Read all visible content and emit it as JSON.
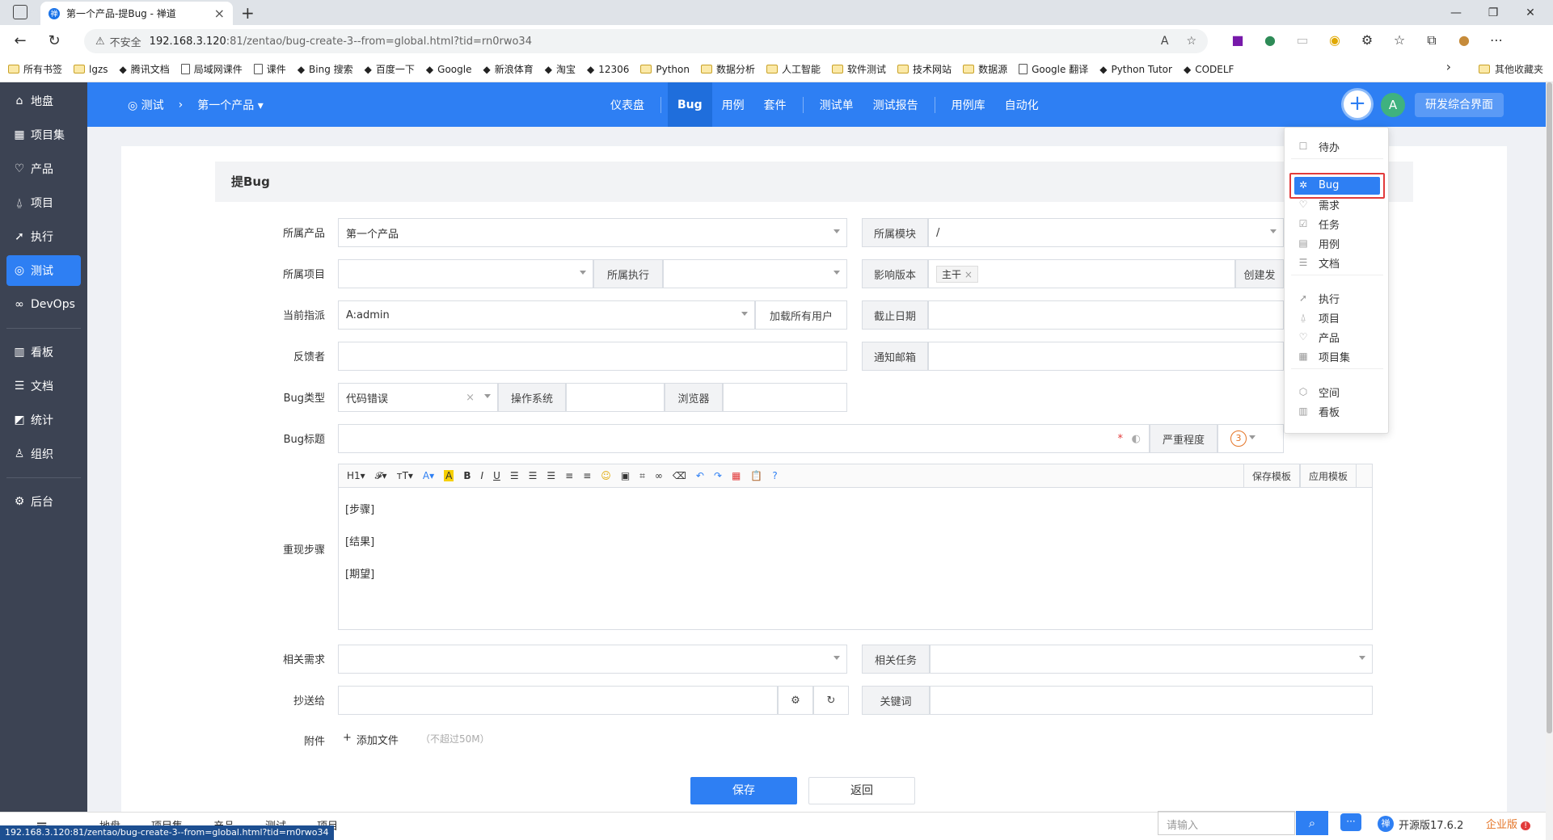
{
  "browser": {
    "tab_title": "第一个产品-提Bug - 禅道",
    "tab_favicon": "zentao-icon",
    "url_warning": "不安全",
    "url_host": "192.168.3.120",
    "url_path": ":81/zentao/bug-create-3--from=global.html?tid=rn0rwo34"
  },
  "bookmarks": [
    {
      "label": "所有书签",
      "icon": "folder-icon"
    },
    {
      "label": "lgzs",
      "icon": "folder-icon"
    },
    {
      "label": "腾讯文档",
      "icon": "tencent-docs-icon"
    },
    {
      "label": "局域网课件",
      "icon": "page-icon"
    },
    {
      "label": "课件",
      "icon": "page-icon"
    },
    {
      "label": "Bing 搜索",
      "icon": "search-icon"
    },
    {
      "label": "百度一下",
      "icon": "baidu-icon"
    },
    {
      "label": "Google",
      "icon": "google-icon"
    },
    {
      "label": "新浪体育",
      "icon": "sina-icon"
    },
    {
      "label": "淘宝",
      "icon": "taobao-icon"
    },
    {
      "label": "12306",
      "icon": "train-icon"
    },
    {
      "label": "Python",
      "icon": "folder-icon"
    },
    {
      "label": "数据分析",
      "icon": "folder-icon"
    },
    {
      "label": "人工智能",
      "icon": "folder-icon"
    },
    {
      "label": "软件测试",
      "icon": "folder-icon"
    },
    {
      "label": "技术网站",
      "icon": "folder-icon"
    },
    {
      "label": "数据源",
      "icon": "folder-icon"
    },
    {
      "label": "Google 翻译",
      "icon": "page-icon"
    },
    {
      "label": "Python Tutor",
      "icon": "python-icon"
    },
    {
      "label": "CODELF",
      "icon": "codelf-icon"
    }
  ],
  "bookmarks_other": "其他收藏夹",
  "sidebar": {
    "items": [
      {
        "label": "地盘",
        "icon": "home-icon"
      },
      {
        "label": "项目集",
        "icon": "grid-icon"
      },
      {
        "label": "产品",
        "icon": "lightbulb-icon"
      },
      {
        "label": "项目",
        "icon": "bell-icon"
      },
      {
        "label": "执行",
        "icon": "run-icon"
      },
      {
        "label": "测试",
        "icon": "test-icon"
      },
      {
        "label": "DevOps",
        "icon": "infinity-icon"
      },
      {
        "label": "看板",
        "icon": "kanban-icon"
      },
      {
        "label": "文档",
        "icon": "doc-icon"
      },
      {
        "label": "统计",
        "icon": "chart-icon"
      },
      {
        "label": "组织",
        "icon": "people-icon"
      },
      {
        "label": "后台",
        "icon": "gear-icon"
      }
    ]
  },
  "header": {
    "crumb_root": "测试",
    "crumb_product": "第一个产品",
    "nav": [
      "仪表盘",
      "Bug",
      "用例",
      "套件",
      "测试单",
      "测试报告",
      "用例库",
      "自动化"
    ],
    "avatar": "A",
    "switch_label": "研发综合界面"
  },
  "form": {
    "title": "提Bug",
    "product_label": "所属产品",
    "product_value": "第一个产品",
    "module_label": "所属模块",
    "module_value": "/",
    "project_label": "所属项目",
    "execution_label": "所属执行",
    "build_label": "影响版本",
    "build_tag": "主干",
    "create_build": "创建发",
    "assign_label": "当前指派",
    "assign_value": "A:admin",
    "load_users": "加载所有用户",
    "deadline_label": "截止日期",
    "feedback_label": "反馈者",
    "notify_label": "通知邮箱",
    "type_label": "Bug类型",
    "type_value": "代码错误",
    "os_label": "操作系统",
    "browser_label": "浏览器",
    "title_label": "Bug标题",
    "severity_label": "严重程度",
    "severity_value": "3",
    "steps_label": "重现步骤",
    "steps": [
      "[步骤]",
      "[结果]",
      "[期望]"
    ],
    "save_template": "保存模板",
    "apply_template": "应用模板",
    "story_label": "相关需求",
    "task_label": "相关任务",
    "cc_label": "抄送给",
    "keywords_label": "关键词",
    "files_label": "附件",
    "add_file": "添加文件",
    "file_hint": "（不超过50M）",
    "save": "保存",
    "back": "返回"
  },
  "dropdown": {
    "items": [
      {
        "label": "待办",
        "icon": "todo-icon"
      },
      {
        "label": "Bug",
        "icon": "bug-icon"
      },
      {
        "label": "需求",
        "icon": "lightbulb-icon"
      },
      {
        "label": "任务",
        "icon": "check-icon"
      },
      {
        "label": "用例",
        "icon": "case-icon"
      },
      {
        "label": "文档",
        "icon": "doc-icon"
      },
      {
        "label": "执行",
        "icon": "run-icon"
      },
      {
        "label": "项目",
        "icon": "bell-icon"
      },
      {
        "label": "产品",
        "icon": "lightbulb-icon"
      },
      {
        "label": "项目集",
        "icon": "grid-icon"
      },
      {
        "label": "空间",
        "icon": "cube-icon"
      },
      {
        "label": "看板",
        "icon": "kanban-icon"
      }
    ]
  },
  "footer": {
    "nav": [
      "地盘",
      "项目集",
      "产品",
      "测试",
      "项目"
    ],
    "search_placeholder": "请输入",
    "version": "开源版17.6.2",
    "enterprise": "企业版"
  },
  "status_url": "192.168.3.120:81/zentao/bug-create-3--from=global.html?tid=rn0rwo34",
  "colors": {
    "accent": "#2e7ff3",
    "sidebar": "#3c4353",
    "highlight": "#e23b3b"
  }
}
